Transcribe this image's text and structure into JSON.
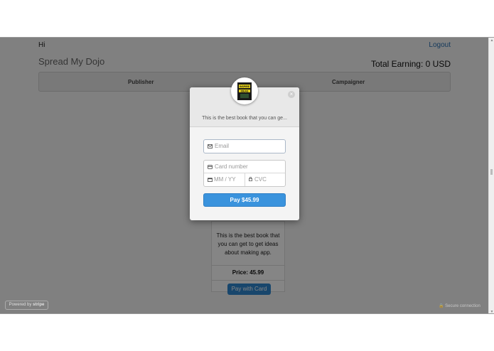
{
  "header": {
    "greeting": "Hi",
    "logout_label": "Logout",
    "brand": "Spread My Dojo",
    "earning": "Total Earning: 0 USD"
  },
  "nav": {
    "publisher": "Publisher",
    "campaigner": "Campaigner"
  },
  "product": {
    "description": "This is the best book that you can get to get ideas about making app.",
    "price": "Price: 45.99",
    "pay_button": "Pay with Card"
  },
  "checkout": {
    "description": "This is the best book that you can ge...",
    "email_placeholder": "Email",
    "card_number_placeholder": "Card number",
    "expiry_placeholder": "MM / YY",
    "cvc_placeholder": "CVC",
    "pay_label": "Pay $45.99",
    "close_glyph": "×",
    "book_cover_text": "INSPIRE IDEAS"
  },
  "footer": {
    "powered_prefix": "Powered by",
    "powered_brand": "stripe",
    "secure": "Secure connection"
  },
  "icons": {
    "email": "envelope-icon",
    "card": "credit-card-icon",
    "expiry": "calendar-icon",
    "cvc": "lock-icon",
    "close": "close-icon"
  },
  "colors": {
    "accent": "#3a93dd",
    "link": "#2a6fb0"
  }
}
